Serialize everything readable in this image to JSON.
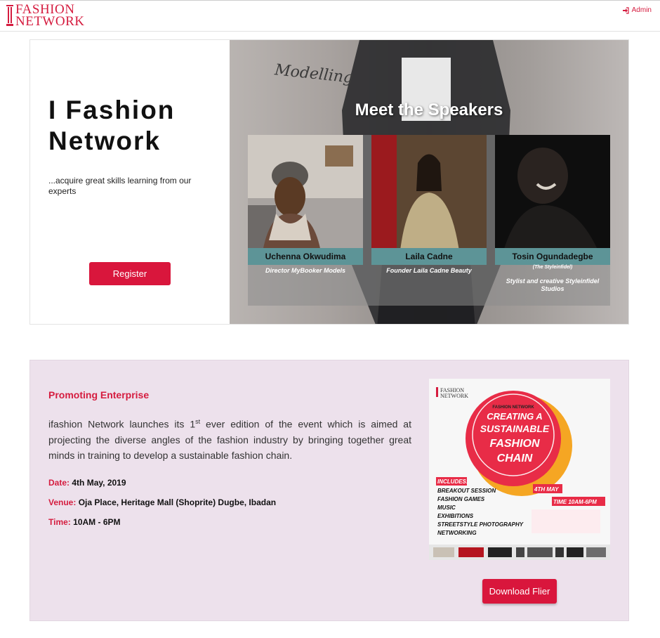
{
  "header": {
    "logo_line1": "FASHION",
    "logo_line2": "NETWORK",
    "admin_label": "Admin"
  },
  "hero": {
    "title": "I Fashion Network",
    "subtitle": "...acquire great skills learning from our experts",
    "register_label": "Register",
    "banner": {
      "script_text": "Modelling",
      "heading": "Meet the Speakers",
      "speakers": [
        {
          "name": "Uchenna Okwudima",
          "tag": "",
          "role": "Director MyBooker Models"
        },
        {
          "name": "Laila Cadne",
          "tag": "",
          "role": "Founder Laila Cadne Beauty"
        },
        {
          "name": "Tosin Ogundadegbe",
          "tag": "(The Styleinfidel)",
          "role": "Stylist and creative Styleinfidel Studios"
        }
      ]
    }
  },
  "event": {
    "heading": "Promoting Enterprise",
    "desc_before": "ifashion Network launches its 1",
    "desc_sup": "st",
    "desc_after": " ever edition of the event which is aimed at projecting the diverse angles of the fashion industry by bringing together great minds in training to develop a sustainable fashion chain.",
    "date_label": "Date:",
    "date_value": "4th May, 2019",
    "venue_label": "Venue:",
    "venue_value": "Oja Place, Heritage Mall (Shoprite) Dugbe, Ibadan",
    "time_label": "Time:",
    "time_value": "10AM - 6PM",
    "download_label": "Download Flier",
    "flier": {
      "logo_line1": "FASHION",
      "logo_line2": "NETWORK",
      "circle_small": "FASHION NETWORK",
      "circle_lines": [
        "CREATING A",
        "SUSTAINABLE",
        "FASHION",
        "CHAIN"
      ],
      "includes_label": "INCLUDES:",
      "includes": [
        "BREAKOUT SESSION",
        "FASHION GAMES",
        "MUSIC",
        "EXHIBITIONS",
        "STREETSTYLE PHOTOGRAPHY",
        "NETWORKING"
      ],
      "date_badge": "4TH MAY",
      "time_badge": "TIME 10AM-6PM"
    }
  },
  "colors": {
    "brand": "#d51c3f",
    "button": "#d9163c",
    "event_bg": "#ede1ec",
    "speaker_bar": "#5d9497"
  },
  "icons": {
    "admin": "sign-in-icon"
  }
}
